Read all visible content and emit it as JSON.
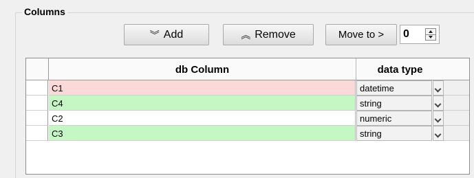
{
  "group": {
    "title": "Columns"
  },
  "toolbar": {
    "add_label": "Add",
    "remove_label": "Remove",
    "move_label": "Move to >",
    "move_value": "0"
  },
  "table": {
    "headers": {
      "db_column": "db Column",
      "data_type": "data type"
    },
    "rows": [
      {
        "name": "C1",
        "type": "datetime",
        "color": "#fcd9d9"
      },
      {
        "name": "C4",
        "type": "string",
        "color": "#c5f7c5"
      },
      {
        "name": "C2",
        "type": "numeric",
        "color": "#ffffff"
      },
      {
        "name": "C3",
        "type": "string",
        "color": "#c5f7c5"
      }
    ]
  }
}
